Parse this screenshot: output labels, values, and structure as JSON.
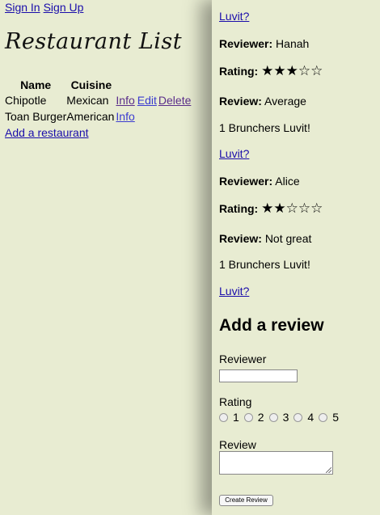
{
  "nav": {
    "sign_in": "Sign In",
    "sign_up": "Sign Up"
  },
  "app_title": "Restaurant List",
  "table": {
    "headers": [
      "Name",
      "Cuisine"
    ],
    "rows": [
      {
        "name": "Chipotle",
        "cuisine": "Mexican",
        "info": "Info",
        "edit": "Edit",
        "delete": "Delete"
      },
      {
        "name": "Toan Burger",
        "cuisine": "American",
        "info": "Info"
      }
    ]
  },
  "add_restaurant_link": "Add a restaurant",
  "reviews": [
    {
      "luvit_link": "Luvit?"
    },
    {
      "reviewer_label": "Reviewer:",
      "reviewer": "Hanah",
      "rating_label": "Rating:",
      "rating_stars": "★★★☆☆",
      "rating_value": 3,
      "review_label": "Review:",
      "review": "Average",
      "luvit_count": "1 Brunchers Luvit!",
      "luvit_link": "Luvit?"
    },
    {
      "reviewer_label": "Reviewer:",
      "reviewer": "Alice",
      "rating_label": "Rating:",
      "rating_stars": "★★☆☆☆",
      "rating_value": 2,
      "review_label": "Review:",
      "review": "Not great",
      "luvit_count": "1 Brunchers Luvit!",
      "luvit_link": "Luvit?"
    }
  ],
  "add_review": {
    "heading": "Add a review",
    "reviewer_label": "Reviewer",
    "reviewer_value": "",
    "rating_label": "Rating",
    "rating_options": [
      "1",
      "2",
      "3",
      "4",
      "5"
    ],
    "review_label": "Review",
    "review_value": "",
    "submit_label": "Create Review"
  }
}
